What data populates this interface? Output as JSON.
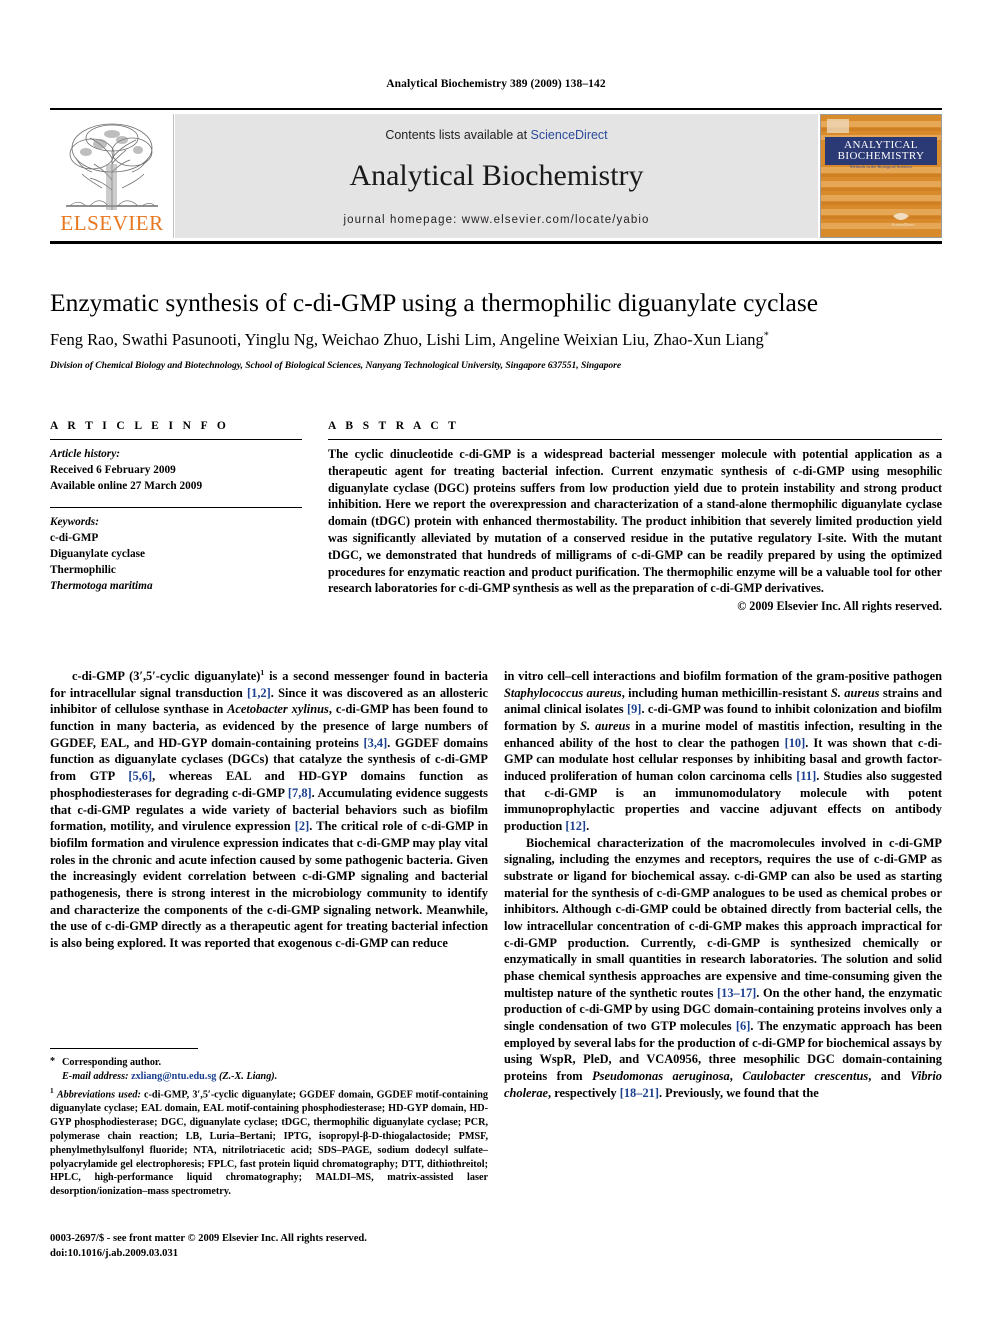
{
  "running_head": "Analytical Biochemistry 389 (2009) 138–142",
  "masthead": {
    "publisher_name": "ELSEVIER",
    "contents_prefix": "Contents lists available at ",
    "contents_link": "ScienceDirect",
    "journal_name": "Analytical Biochemistry",
    "homepage_line": "journal homepage: www.elsevier.com/locate/yabio",
    "cover": {
      "line1": "ANALYTICAL",
      "line2": "BIOCHEMISTRY",
      "tagline": "Methods in the Biological Sciences",
      "publisher_mark": "ScienceDirect"
    },
    "colors": {
      "band_bg": "#e4e4e4",
      "link_blue": "#2b4a9b",
      "elsevier_orange": "#E87722",
      "cover_orange": "#d98b2b",
      "cover_navy": "#2b3a75"
    }
  },
  "article": {
    "title": "Enzymatic synthesis of c-di-GMP using a thermophilic diguanylate cyclase",
    "authors": "Feng Rao, Swathi Pasunooti, Yinglu Ng, Weichao Zhuo, Lishi Lim, Angeline Weixian Liu, Zhao-Xun Liang",
    "author_marker": "*",
    "affiliation": "Division of Chemical Biology and Biotechnology, School of Biological Sciences, Nanyang Technological University, Singapore 637551, Singapore"
  },
  "article_info": {
    "heading": "A R T I C L E  I N F O",
    "history_label": "Article history:",
    "history": [
      "Received 6 February 2009",
      "Available online 27 March 2009"
    ],
    "keywords_label": "Keywords:",
    "keywords": [
      "c-di-GMP",
      "Diguanylate cyclase",
      "Thermophilic",
      "Thermotoga maritima"
    ],
    "keywords_italic_index": 3
  },
  "abstract": {
    "heading": "A B S T R A C T",
    "text": "The cyclic dinucleotide c-di-GMP is a widespread bacterial messenger molecule with potential application as a therapeutic agent for treating bacterial infection. Current enzymatic synthesis of c-di-GMP using mesophilic diguanylate cyclase (DGC) proteins suffers from low production yield due to protein instability and strong product inhibition. Here we report the overexpression and characterization of a stand-alone thermophilic diguanylate cyclase domain (tDGC) protein with enhanced thermostability. The product inhibition that severely limited production yield was significantly alleviated by mutation of a conserved residue in the putative regulatory I-site. With the mutant tDGC, we demonstrated that hundreds of milligrams of c-di-GMP can be readily prepared by using the optimized procedures for enzymatic reaction and product purification. The thermophilic enzyme will be a valuable tool for other research laboratories for c-di-GMP synthesis as well as the preparation of c-di-GMP derivatives.",
    "copyright": "© 2009 Elsevier Inc. All rights reserved."
  },
  "body": {
    "left_paragraph_1_parts": {
      "p1a": "c-di-GMP (3′,5′-cyclic diguanylate)",
      "fn_marker": "1",
      "p1b": " is a second messenger found in bacteria for intracellular signal transduction ",
      "r1": "[1,2]",
      "p1c": ". Since it was discovered as an allosteric inhibitor of cellulose synthase in ",
      "i1": "Acetobacter xylinus",
      "p1d": ", c-di-GMP has been found to function in many bacteria, as evidenced by the presence of large numbers of GGDEF, EAL, and HD-GYP domain-containing proteins ",
      "r2": "[3,4]",
      "p1e": ". GGDEF domains function as diguanylate cyclases (DGCs) that catalyze the synthesis of c-di-GMP from GTP ",
      "r3": "[5,6]",
      "p1f": ", whereas EAL and HD-GYP domains function as phosphodiesterases for degrading c-di-GMP ",
      "r4": "[7,8]",
      "p1g": ". Accumulating evidence suggests that c-di-GMP regulates a wide variety of bacterial behaviors such as biofilm formation, motility, and virulence expression ",
      "r5": "[2]",
      "p1h": ". The critical role of c-di-GMP in biofilm formation and virulence expression indicates that c-di-GMP may play vital roles in the chronic and acute infection caused by some pathogenic bacteria. Given the increasingly evident correlation between c-di-GMP signaling and bacterial pathogenesis, there is strong interest in the microbiology community to identify and characterize the components of the c-di-GMP signaling network. Meanwhile, the use of c-di-GMP directly as a therapeutic agent for treating bacterial infection is also being explored. It was reported that exogenous c-di-GMP can reduce"
    },
    "right_paragraph_1_parts": {
      "p1a": "in vitro cell–cell interactions and biofilm formation of the gram-positive pathogen ",
      "i1": "Staphylococcus aureus",
      "p1b": ", including human methicillin-resistant ",
      "i2": "S. aureus",
      "p1c": " strains and animal clinical isolates ",
      "r1": "[9]",
      "p1d": ". c-di-GMP was found to inhibit colonization and biofilm formation by ",
      "i3": "S. aureus",
      "p1e": " in a murine model of mastitis infection, resulting in the enhanced ability of the host to clear the pathogen ",
      "r2": "[10]",
      "p1f": ". It was shown that c-di-GMP can modulate host cellular responses by inhibiting basal and growth factor-induced proliferation of human colon carcinoma cells ",
      "r3": "[11]",
      "p1g": ". Studies also suggested that c-di-GMP is an immunomodulatory molecule with potent immunoprophylactic properties and vaccine adjuvant effects on antibody production ",
      "r4": "[12]",
      "p1h": "."
    },
    "right_paragraph_2_parts": {
      "p2a": "Biochemical characterization of the macromolecules involved in c-di-GMP signaling, including the enzymes and receptors, requires the use of c-di-GMP as substrate or ligand for biochemical assay. c-di-GMP can also be used as starting material for the synthesis of c-di-GMP analogues to be used as chemical probes or inhibitors. Although c-di-GMP could be obtained directly from bacterial cells, the low intracellular concentration of c-di-GMP makes this approach impractical for c-di-GMP production. Currently, c-di-GMP is synthesized chemically or enzymatically in small quantities in research laboratories. The solution and solid phase chemical synthesis approaches are expensive and time-consuming given the multistep nature of the synthetic routes ",
      "r1": "[13–17]",
      "p2b": ". On the other hand, the enzymatic production of c-di-GMP by using DGC domain-containing proteins involves only a single condensation of two GTP molecules ",
      "r2": "[6]",
      "p2c": ". The enzymatic approach has been employed by several labs for the production of c-di-GMP for biochemical assays by using WspR, PleD, and VCA0956, three mesophilic DGC domain-containing proteins from ",
      "i1": "Pseudomonas aeruginosa",
      "p2d": ", ",
      "i2": "Caulobacter crescentus",
      "p2e": ", and ",
      "i3": "Vibrio cholerae",
      "p2f": ", respectively ",
      "r3": "[18–21]",
      "p2g": ". Previously, we found that the"
    }
  },
  "footnotes": {
    "corresponding": "Corresponding author.",
    "corresponding_marker": "*",
    "email_label": "E-mail address:",
    "email": "zxliang@ntu.edu.sg",
    "email_suffix": " (Z.-X. Liang).",
    "abbrev_marker": "1",
    "abbrev_label": "Abbreviations used:",
    "abbrev_text": " c-di-GMP, 3′,5′-cyclic diguanylate; GGDEF domain, GGDEF motif-containing diguanylate cyclase; EAL domain, EAL motif-containing phosphodiesterase; HD-GYP domain, HD-GYP phosphodiesterase; DGC, diguanylate cyclase; tDGC, thermophilic diguanylate cyclase; PCR, polymerase chain reaction; LB, Luria–Bertani; IPTG, isopropyl-β-D-thiogalactoside; PMSF, phenylmethylsulfonyl fluoride; NTA, nitrilotriacetic acid; SDS–PAGE, sodium dodecyl sulfate–polyacrylamide gel electrophoresis; FPLC, fast protein liquid chromatography; DTT, dithiothreitol; HPLC, high-performance liquid chromatography; MALDI–MS, matrix-assisted laser desorption/ionization–mass spectrometry."
  },
  "footer": {
    "issn_line": "0003-2697/$ - see front matter © 2009 Elsevier Inc. All rights reserved.",
    "doi_line": "doi:10.1016/j.ab.2009.03.031"
  }
}
